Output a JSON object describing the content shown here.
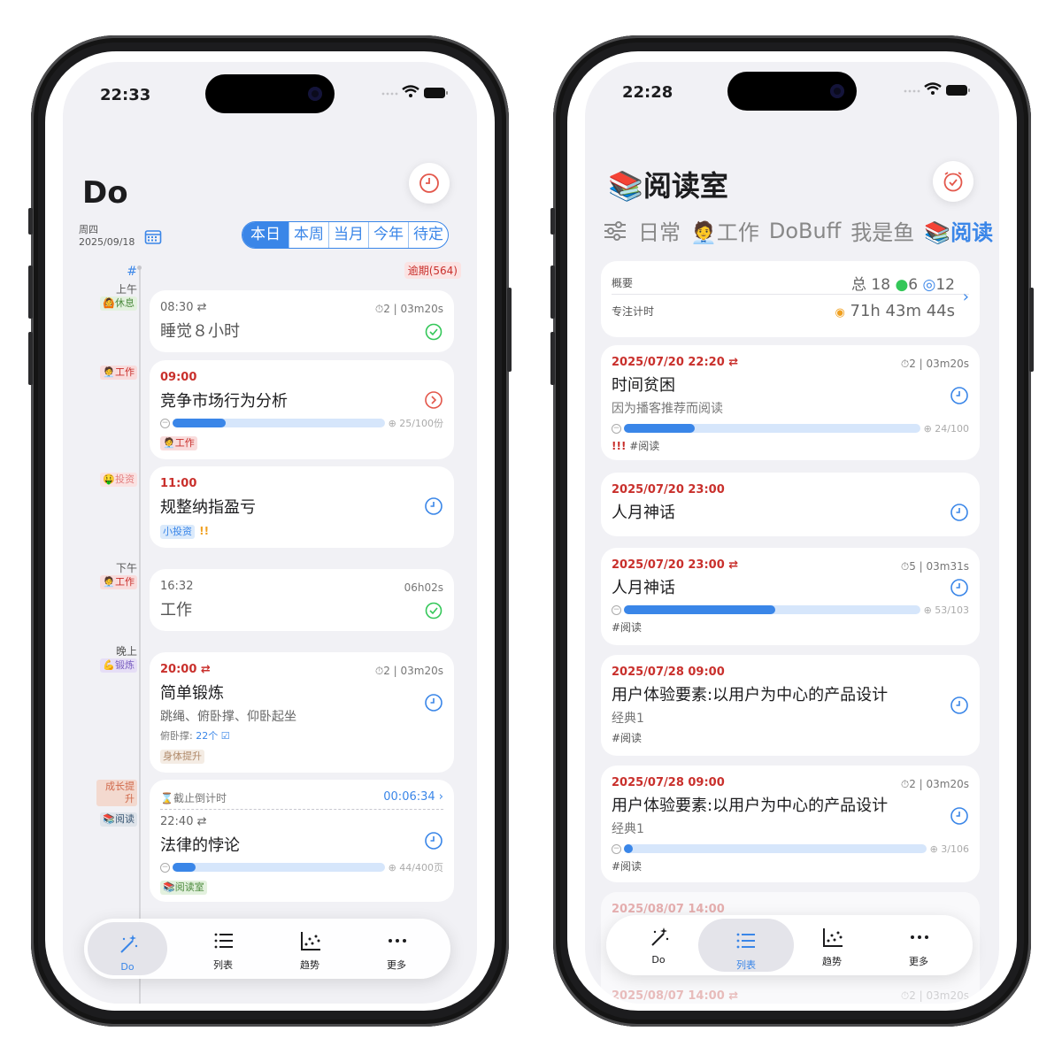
{
  "left": {
    "status_time": "22:33",
    "title": "Do",
    "weekday": "周四",
    "date": "2025/09/18",
    "segments": [
      "本日",
      "本周",
      "当月",
      "今年",
      "待定"
    ],
    "hash": "#",
    "overdue": "逾期(564)",
    "labels": {
      "morning": "上午",
      "rest": "🙆休息",
      "work": "🧑‍💼工作",
      "invest": "🤑投资",
      "afternoon": "下午",
      "work2": "🧑‍💼工作",
      "evening": "晚上",
      "exercise": "💪锻炼",
      "growth": "成长提升",
      "read": "📚阅读"
    },
    "cards": [
      {
        "time": "08:30 ⇄",
        "title": "睡觉８小时",
        "meta": "⏱2 | 03m20s"
      },
      {
        "time": "09:00",
        "title": "竞争市场行为分析",
        "progress": 0.25,
        "progress_text": "⊕ 25/100份",
        "tag": "🧑‍💼工作"
      },
      {
        "time": "11:00",
        "title": "规整纳指盈亏",
        "tag": "小投资",
        "flag": "!!"
      },
      {
        "time": "16:32",
        "title": "工作",
        "meta": "06h02s"
      },
      {
        "time": "20:00 ⇄",
        "title": "简单锻炼",
        "meta": "⏱2 | 03m20s",
        "sub": "跳绳、俯卧撑、仰卧起坐",
        "note_label": "俯卧撑:",
        "note_value": "22个 ☑",
        "tag": "身体提升"
      },
      {
        "countdown_label": "⌛截止倒计时",
        "countdown_value": "00:06:34",
        "time": "22:40 ⇄",
        "title": "法律的悖论",
        "progress": 0.11,
        "progress_text": "⊕ 44/400页",
        "tag": "📚阅读室"
      }
    ],
    "tabs": [
      {
        "label": "Do",
        "icon": "wand-icon"
      },
      {
        "label": "列表",
        "icon": "list-icon"
      },
      {
        "label": "趋势",
        "icon": "chart-icon"
      },
      {
        "label": "更多",
        "icon": "more-icon"
      }
    ],
    "active_tab": "Do"
  },
  "right": {
    "status_time": "22:28",
    "title": "📚阅读室",
    "filters": [
      "日常",
      "🧑‍💼工作",
      "DoBuff",
      "我是鱼",
      "📚阅读"
    ],
    "summary": {
      "overview_label": "概要",
      "total": "总 18",
      "done": "6",
      "pending": "12",
      "focus_label": "专注计时",
      "focus_value": "71h 43m 44s"
    },
    "cards": [
      {
        "date": "2025/07/20 22:20 ⇄",
        "meta": "⏱2 | 03m20s",
        "title": "时间贫困",
        "sub": "因为播客推荐而阅读",
        "progress": 0.24,
        "progress_text": "⊕ 24/100",
        "priority": "!!!",
        "tag": "#阅读"
      },
      {
        "date": "2025/07/20 23:00",
        "title": "人月神话"
      },
      {
        "date": "2025/07/20 23:00 ⇄",
        "meta": "⏱5 | 03m31s",
        "title": "人月神话",
        "progress": 0.51,
        "progress_text": "⊕ 53/103",
        "tag": "#阅读"
      },
      {
        "date": "2025/07/28 09:00",
        "title": "用户体验要素:以用户为中心的产品设计",
        "sub": "经典1",
        "tag": "#阅读"
      },
      {
        "date": "2025/07/28 09:00",
        "meta": "⏱2 | 03m20s",
        "title": "用户体验要素:以用户为中心的产品设计",
        "sub": "经典1",
        "progress": 0.03,
        "progress_text": "⊕ 3/106",
        "tag": "#阅读"
      }
    ],
    "peek_top": "2025/08/07 14:00",
    "peek_bottom": "2025/08/07 14:00 ⇄",
    "peek_meta": "⏱2 | 03m20s",
    "tabs": [
      {
        "label": "Do",
        "icon": "wand-icon"
      },
      {
        "label": "列表",
        "icon": "list-icon"
      },
      {
        "label": "趋势",
        "icon": "chart-icon"
      },
      {
        "label": "更多",
        "icon": "more-icon"
      }
    ],
    "active_tab": "列表"
  },
  "colors": {
    "accent": "#3a86e8",
    "overdue": "#c9302c",
    "done": "#34c759",
    "alert": "#e3574b"
  }
}
